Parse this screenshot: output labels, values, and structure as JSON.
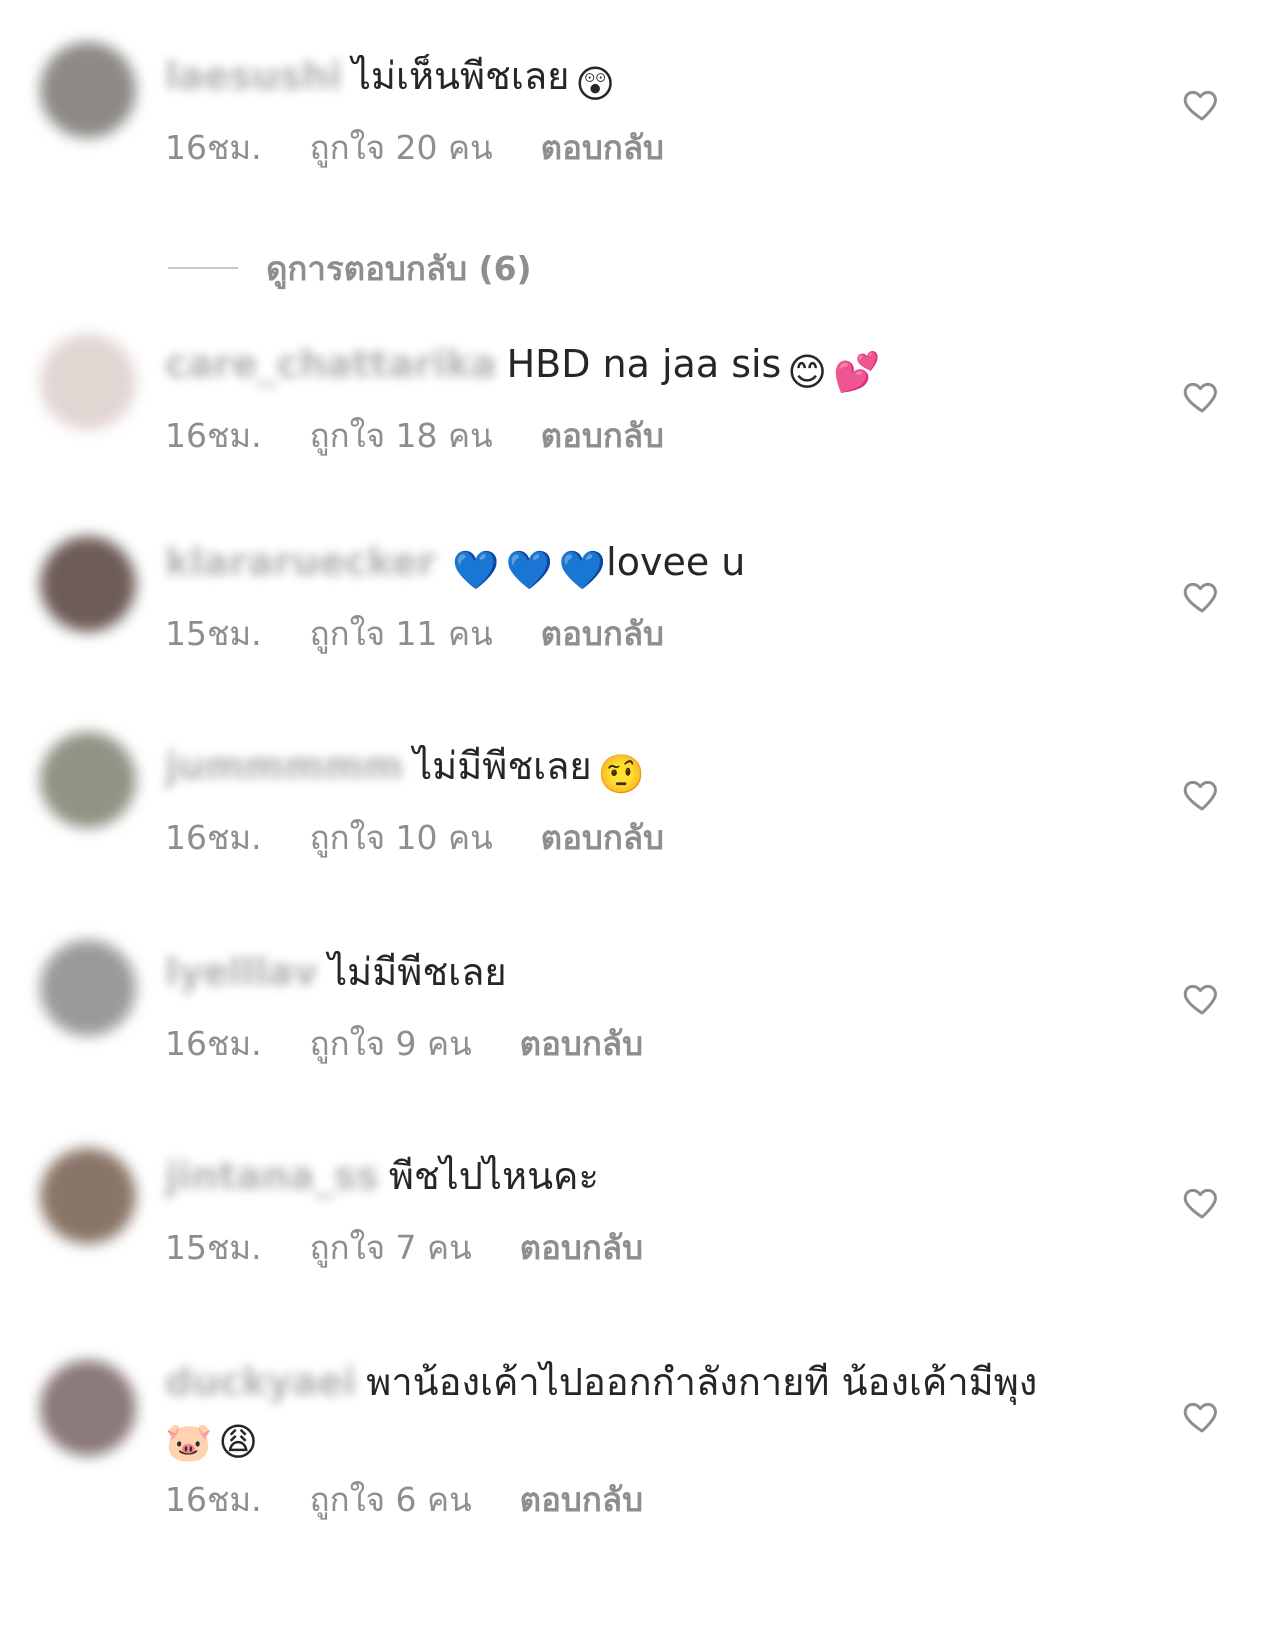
{
  "comments": [
    {
      "username": "laesushi",
      "text": "ไม่เห็นพีชเลย",
      "emojis": [
        "😲"
      ],
      "time": "16ชม.",
      "likes": "ถูกใจ 20 คน",
      "reply": "ตอบกลับ",
      "avatar_color": "#8d8a86"
    },
    {
      "username": "care_chattarika",
      "text": "HBD na  jaa sis",
      "emojis": [
        "😊",
        "💕"
      ],
      "time": "16ชม.",
      "likes": "ถูกใจ 18 คน",
      "reply": "ตอบกลับ",
      "avatar_color": "#e2d6d3"
    },
    {
      "username": "klararuecker",
      "text": "lovee u",
      "emojis": [
        "💙",
        "💙",
        "💙"
      ],
      "time": "15ชม.",
      "likes": "ถูกใจ 11 คน",
      "reply": "ตอบกลับ",
      "avatar_color": "#6e5c57"
    },
    {
      "username": "jummmmm",
      "text": "ไม่มีพีชเลย",
      "emojis": [
        "🤨"
      ],
      "time": "16ชม.",
      "likes": "ถูกใจ 10 คน",
      "reply": "ตอบกลับ",
      "avatar_color": "#8f9484"
    },
    {
      "username": "lyelllav",
      "text": "ไม่มีพีชเลย",
      "emojis": [],
      "time": "16ชม.",
      "likes": "ถูกใจ 9 คน",
      "reply": "ตอบกลับ",
      "avatar_color": "#9a9a9a"
    },
    {
      "username": "jintana_ss",
      "text": "พีชไปไหนคะ",
      "emojis": [],
      "time": "15ชม.",
      "likes": "ถูกใจ 7 คน",
      "reply": "ตอบกลับ",
      "avatar_color": "#8a7668"
    },
    {
      "username": "duckyaei",
      "text": "พาน้องเค้าไปออกกำลังกายที น้องเค้ามีพุง",
      "emojis": [
        "🐷",
        "😩"
      ],
      "time": "16ชม.",
      "likes": "ถูกใจ 6 คน",
      "reply": "ตอบกลับ",
      "avatar_color": "#8a7a79"
    }
  ],
  "view_replies": "ดูการตอบกลับ (6)",
  "icons": {
    "like": "heart-outline-icon"
  },
  "colors": {
    "text": "#262626",
    "muted": "#8e8e8e",
    "divider": "#c7c7c7"
  }
}
